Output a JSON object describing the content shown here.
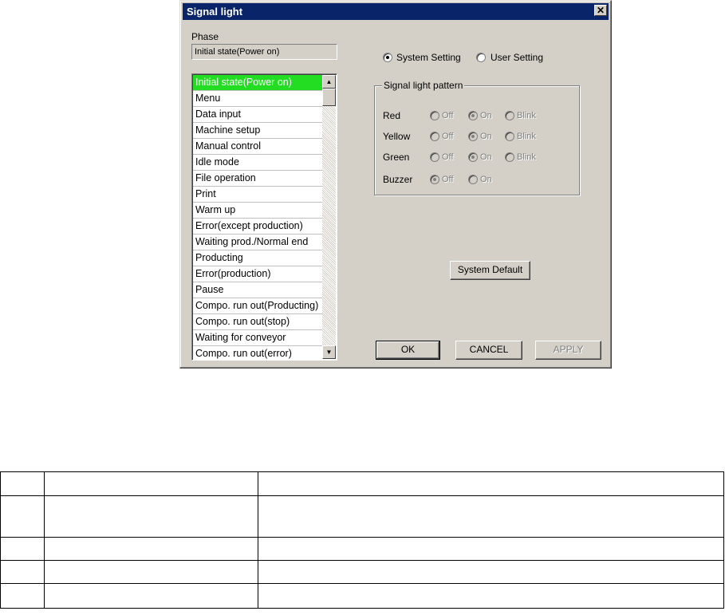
{
  "window": {
    "title": "Signal light",
    "close_glyph": "✕"
  },
  "phase": {
    "label": "Phase",
    "current": "Initial state(Power on)",
    "items": [
      "Initial state(Power on)",
      "Menu",
      "Data input",
      "Machine setup",
      "Manual control",
      "Idle mode",
      "File operation",
      "Print",
      "Warm up",
      "Error(except production)",
      "Waiting prod./Normal end",
      "Producting",
      "Error(production)",
      "Pause",
      "Compo. run out(Producting)",
      "Compo. run out(stop)",
      "Waiting for conveyor",
      "Compo. run out(error)"
    ],
    "selected_index": 0
  },
  "setting_mode": {
    "system_label": "System Setting",
    "user_label": "User Setting",
    "selected": "system"
  },
  "pattern": {
    "title": "Signal light pattern",
    "rows": [
      {
        "name": "Red",
        "options": [
          "Off",
          "On",
          "Blink"
        ],
        "selected": "On"
      },
      {
        "name": "Yellow",
        "options": [
          "Off",
          "On",
          "Blink"
        ],
        "selected": "On"
      },
      {
        "name": "Green",
        "options": [
          "Off",
          "On",
          "Blink"
        ],
        "selected": "On"
      },
      {
        "name": "Buzzer",
        "options": [
          "Off",
          "On"
        ],
        "selected": "Off"
      }
    ]
  },
  "buttons": {
    "system_default": "System Default",
    "ok": "OK",
    "cancel": "CANCEL",
    "apply": "APPLY"
  },
  "icons": {
    "scroll_up": "▲",
    "scroll_down": "▼"
  },
  "colors": {
    "title_bar": "#0a246a",
    "selection": "#22dd22",
    "face": "#d4d0c8"
  }
}
